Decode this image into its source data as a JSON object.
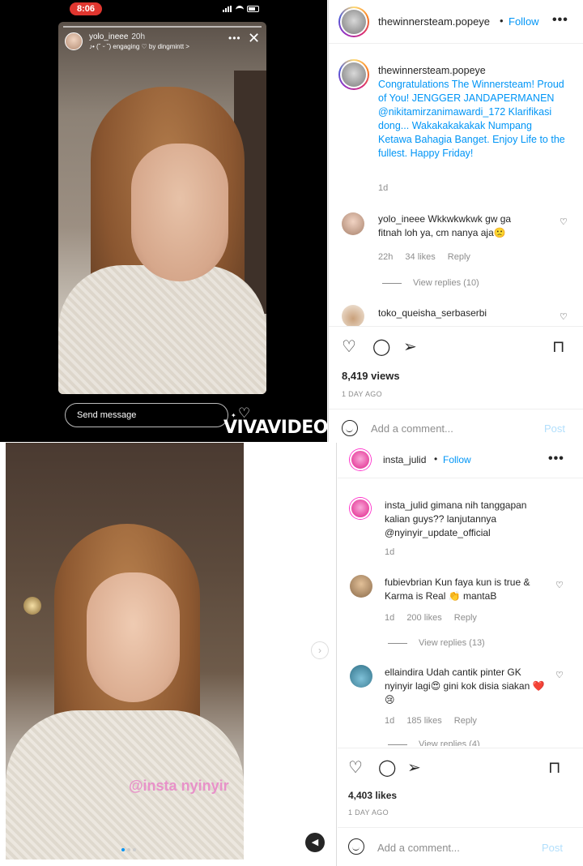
{
  "story_top": {
    "status_time": "8:06",
    "username": "yolo_ineee",
    "time": "20h",
    "music": "♪• (˘ ᵕ ˘) engaging ♡ by dingmintt >",
    "more": "•••",
    "close": "✕",
    "send_message": "Send message",
    "brand": "VIVAVIDEO"
  },
  "post_top": {
    "header_user": "thewinnersteam.popeye",
    "follow": "Follow",
    "more": "•••",
    "caption_user": "thewinnersteam.popeye",
    "caption": "Congratulations The Winnersteam! Proud of You! JENGGER JANDAPERMANEN @nikitamirzanimawardi_172 Klarifikasi dong... Wakakakakakak Numpang Ketawa Bahagia Banget. Enjoy Life to the fullest. Happy Friday!",
    "caption_time": "1d",
    "comments": [
      {
        "user": "yolo_ineee",
        "text": "Wkkwkwkwk gw ga fitnah loh ya, cm nanya aja🙁",
        "time": "22h",
        "likes": "34 likes",
        "reply": "Reply",
        "view_replies": "View replies (10)"
      },
      {
        "user": "toko_queisha_serbaserbi"
      }
    ],
    "views": "8,419 views",
    "date": "1 DAY AGO",
    "add_comment_placeholder": "Add a comment...",
    "post_label": "Post"
  },
  "story_bottom": {
    "watermark": "@insta nyinyir"
  },
  "post_bottom": {
    "header_user": "insta_julid",
    "follow": "Follow",
    "more": "•••",
    "caption_user": "insta_julid",
    "caption": "gimana nih tanggapan kalian guys?? lanjutannya @nyinyir_update_official",
    "caption_time": "1d",
    "comments": [
      {
        "user": "fubievbrian",
        "text": "Kun faya kun is true & Karma is Real 👏 mantaB",
        "time": "1d",
        "likes": "200 likes",
        "reply": "Reply",
        "view_replies": "View replies (13)"
      },
      {
        "user": "ellaindira",
        "text": "Udah cantik pinter GK nyinyir lagi😍 gini kok disia siakan ❤️😢",
        "time": "1d",
        "likes": "185 likes",
        "reply": "Reply",
        "view_replies": "View replies (4)"
      }
    ],
    "likes": "4,403 likes",
    "date": "1 DAY AGO",
    "add_comment_placeholder": "Add a comment...",
    "post_label": "Post"
  },
  "icons": {
    "heart": "heart-icon",
    "comment": "comment-icon",
    "share": "send-icon",
    "save": "bookmark-icon",
    "emoji": "emoji-icon",
    "sound": "sound-icon",
    "next": "chevron-right-icon"
  },
  "colors": {
    "link_blue": "#0095f6",
    "muted": "#8e8e8e",
    "status_red": "#e0362f",
    "post_disabled": "#b2dffc"
  }
}
